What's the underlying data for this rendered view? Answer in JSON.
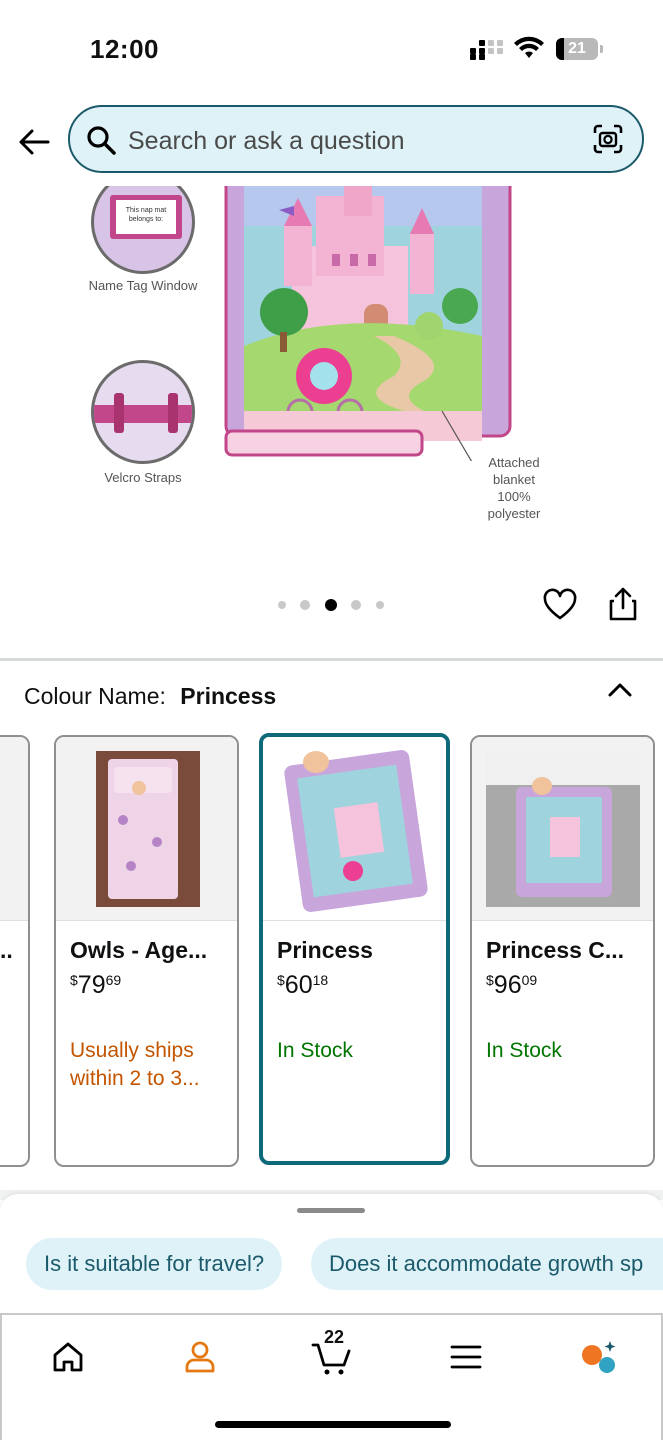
{
  "status_bar": {
    "time": "12:00",
    "battery": "21"
  },
  "search": {
    "placeholder": "Search or ask a question"
  },
  "product_image": {
    "features": [
      {
        "label": "Name Tag Window",
        "tag_text": "This nap mat belongs to:"
      },
      {
        "label": "Velcro Straps"
      }
    ],
    "callout": "Attached blanket 100% polyester"
  },
  "gallery": {
    "dot_count": 5,
    "active_dot": 2
  },
  "colour": {
    "label": "Colour Name:",
    "value": "Princess"
  },
  "variants": [
    {
      "title": "Owls - Age...",
      "price_main": "79",
      "price_cents": "69",
      "price_symbol": "$",
      "status": "Usually ships within 2 to 3...",
      "status_color": "orange",
      "selected": false
    },
    {
      "title": "Princess",
      "price_main": "60",
      "price_cents": "18",
      "price_symbol": "$",
      "status": "In Stock",
      "status_color": "green",
      "selected": true
    },
    {
      "title": "Princess C...",
      "price_main": "96",
      "price_cents": "09",
      "price_symbol": "$",
      "status": "In Stock",
      "status_color": "green",
      "selected": false
    }
  ],
  "partial_card_title": "..",
  "suggestions": [
    "Is it suitable for travel?",
    "Does it accommodate growth sp"
  ],
  "nav": {
    "cart_count": "22",
    "icons": [
      "home-icon",
      "account-icon",
      "cart-icon",
      "menu-icon",
      "rufus-icon"
    ]
  },
  "colors": {
    "accent_teal": "#0e6a7a",
    "search_bg": "#dff2f8",
    "in_stock": "#007600",
    "shipping": "#c45500",
    "account_orange": "#e47911"
  }
}
